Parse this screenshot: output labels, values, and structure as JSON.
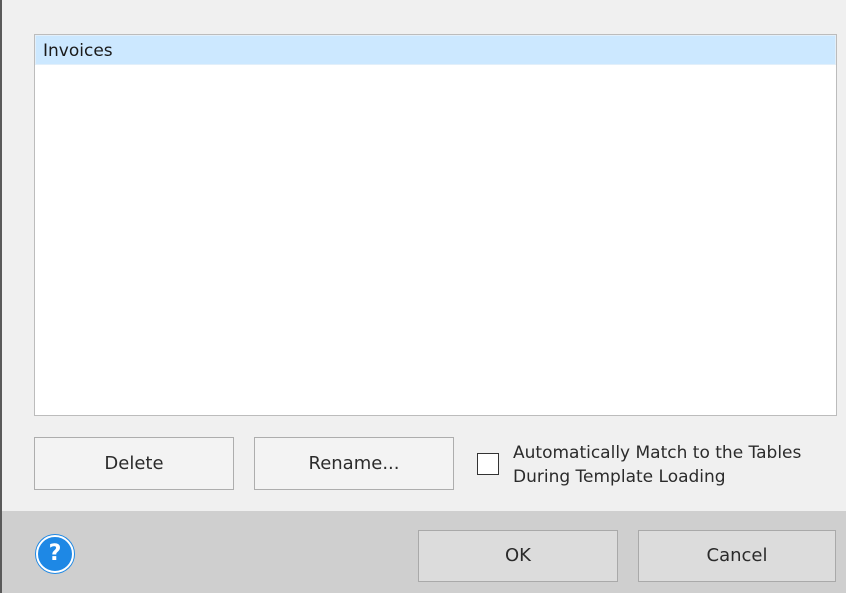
{
  "list": {
    "items": [
      {
        "label": "Invoices",
        "selected": true
      }
    ]
  },
  "buttons": {
    "delete_label": "Delete",
    "rename_label": "Rename..."
  },
  "auto_match": {
    "label": "Automatically Match to the Tables\nDuring Template Loading",
    "checked": false
  },
  "footer": {
    "help_icon": "help-icon",
    "help_glyph": "?",
    "ok_label": "OK",
    "cancel_label": "Cancel"
  },
  "colors": {
    "selection": "#cce8ff",
    "help_icon": "#1e88e5",
    "footer_bg": "#cfcfcf"
  }
}
